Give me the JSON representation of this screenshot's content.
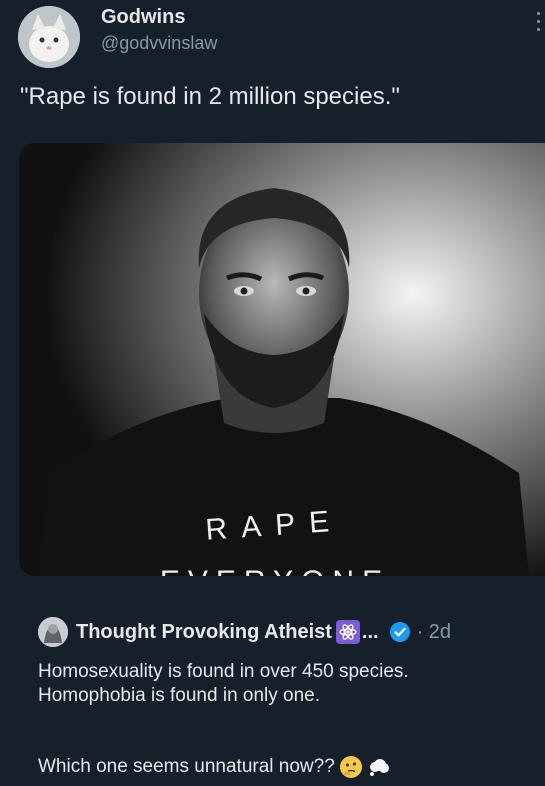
{
  "tweet": {
    "author_name": "Godwins",
    "author_handle": "@godvvinslaw",
    "text": "\"Rape is found in 2 million species.\"",
    "image": {
      "shirt_text_top": "RAPE",
      "shirt_text_bottom": "EVERYONE",
      "icon": "bearded-man-photo"
    }
  },
  "quote": {
    "author_name": "Thought Provoking Atheist",
    "badge_icon": "atom-emoji-icon",
    "ellipsis": "...",
    "verified_icon": "verified-badge-icon",
    "meta": "· 2d",
    "line1": "Homosexuality is found in over 450 species.",
    "line2": "Homophobia is found in only one.",
    "line3": "Which one seems unnatural now??",
    "emoji_icons": [
      "thinking-face-icon",
      "thought-balloon-icon"
    ]
  },
  "colors": {
    "background": "#15202b",
    "text_primary": "#e7e9ea",
    "text_secondary": "#8b98a5",
    "verified_blue": "#1d9bf0",
    "atom_purple": "#7c5cd6"
  }
}
